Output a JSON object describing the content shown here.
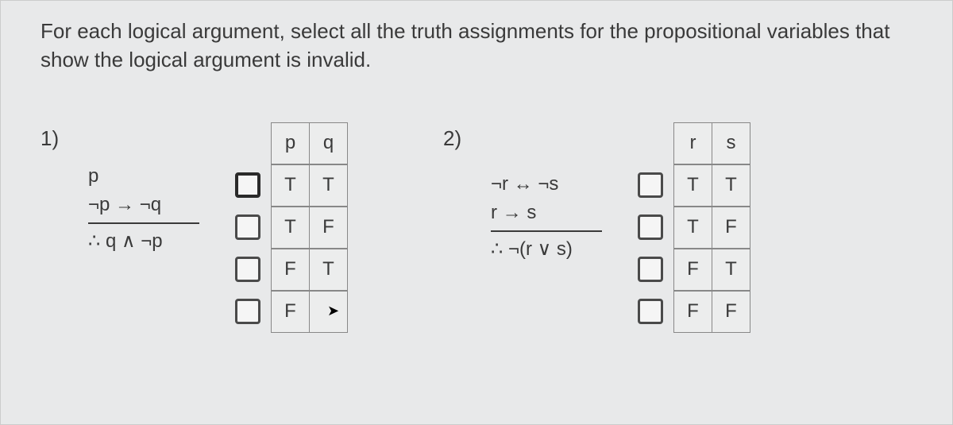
{
  "instruction": "For each logical argument, select all the truth assignments for the propositional variables that show the logical argument is invalid.",
  "problems": [
    {
      "number": "1)",
      "argument": {
        "premises": [
          "p",
          "¬p → ¬q"
        ],
        "conclusion": "∴ q ∧ ¬p"
      },
      "table": {
        "headers": [
          "p",
          "q"
        ],
        "rows": [
          [
            "T",
            "T"
          ],
          [
            "T",
            "F"
          ],
          [
            "F",
            "T"
          ],
          [
            "F",
            ""
          ]
        ]
      }
    },
    {
      "number": "2)",
      "argument": {
        "premises": [
          "¬r ↔ ¬s",
          "r → s"
        ],
        "conclusion": "∴ ¬(r ∨ s)"
      },
      "table": {
        "headers": [
          "r",
          "s"
        ],
        "rows": [
          [
            "T",
            "T"
          ],
          [
            "T",
            "F"
          ],
          [
            "F",
            "T"
          ],
          [
            "F",
            "F"
          ]
        ]
      }
    }
  ]
}
